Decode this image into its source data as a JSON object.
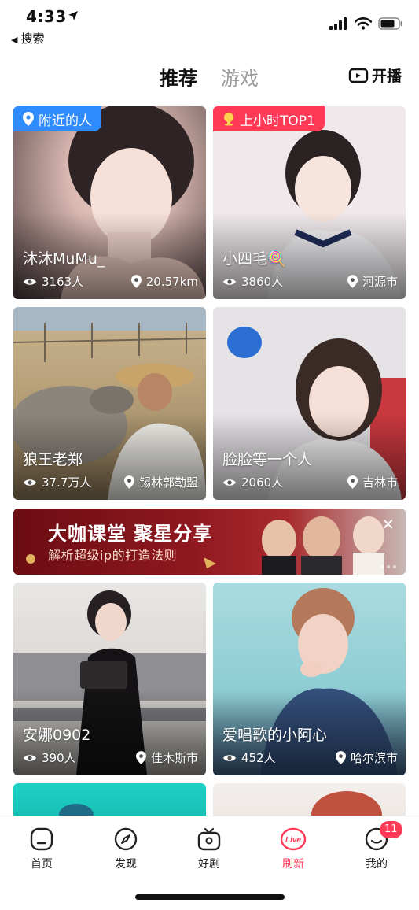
{
  "status_bar": {
    "time": "4:33",
    "back_label": "搜索"
  },
  "header": {
    "tabs": [
      {
        "label": "推荐",
        "active": true
      },
      {
        "label": "游戏",
        "active": false
      }
    ],
    "live_button": "开播"
  },
  "cards": [
    {
      "badge": "附近的人",
      "badge_color": "#2f8cff",
      "name": "沐沐MuMu_",
      "viewers": "3163人",
      "location": "20.57km"
    },
    {
      "badge": "上小时TOP1",
      "badge_color": "#ff3a57",
      "name": "小四毛🍭",
      "viewers": "3860人",
      "location": "河源市"
    },
    {
      "badge": "",
      "name": "狼王老郑",
      "viewers": "37.7万人",
      "location": "锡林郭勒盟"
    },
    {
      "badge": "",
      "name": "脸脸等一个人",
      "viewers": "2060人",
      "location": "吉林市"
    },
    {
      "badge": "",
      "name": "安娜0902",
      "viewers": "390人",
      "location": "佳木斯市"
    },
    {
      "badge": "",
      "name": "爱唱歌的小阿心",
      "viewers": "452人",
      "location": "哈尔滨市"
    }
  ],
  "banner": {
    "title": "大咖课堂 聚星分享",
    "subtitle": "解析超级ip的打造法则"
  },
  "bottom_nav": {
    "items": [
      {
        "label": "首页",
        "icon": "home-icon"
      },
      {
        "label": "发现",
        "icon": "compass-icon"
      },
      {
        "label": "好剧",
        "icon": "tv-icon"
      },
      {
        "label": "刷新",
        "icon": "live-refresh-icon",
        "active": true
      },
      {
        "label": "我的",
        "icon": "smile-face-icon",
        "badge": "11"
      }
    ]
  },
  "colors": {
    "accent": "#ff3a57",
    "nearby_badge": "#2f8cff"
  }
}
